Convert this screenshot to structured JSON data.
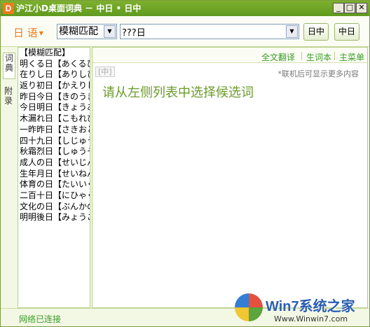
{
  "window": {
    "logo_letter": "D",
    "title": "沪江小D桌面词典 － 中日 • 日中",
    "min_symbol": "_",
    "max_symbol": "□",
    "close_symbol": "✕"
  },
  "toolbar": {
    "language": "日 语",
    "language_caret": "▼",
    "mode_value": "模糊匹配",
    "combo_arrow": "▼",
    "search_value": "???日",
    "btn_jc": "日中",
    "btn_rc": "中日"
  },
  "sidetabs": {
    "dict": "词典",
    "appendix": "附录"
  },
  "list": {
    "header": "【模糊匹配】",
    "items": [
      "明くる日【あくるひ】",
      "在りし日【ありしひ】",
      "返り初日【かえりしょにち】",
      "昨日今日【きのうきょう】",
      "今日明日【きょうあす】",
      "木漏れ日【こもれび】",
      "一昨昨日【さきおととい】",
      "四十九日【しじゅうくにち】",
      "秋霜烈日【しゅうそうれつじつ】",
      "成人の日【せいじんのひ】",
      "生年月日【せいねんがっぴ】",
      "体育の日【たいいくのひ】",
      "二百十日【にひゃくとおか】",
      "文化の日【ぶんかのひ】",
      "明明後日【みょうごにち】"
    ]
  },
  "main": {
    "link_full": "全文翻译",
    "link_vocab": "生词本",
    "link_menu": "主菜单",
    "tag": "[中]",
    "hint": "*联机后可显示更多内容",
    "prompt": "请从左侧列表中选择候选词"
  },
  "status": {
    "text": "网络已连接"
  },
  "watermark": {
    "text": "Win7系统之家",
    "url": "Www.Winwin7.com"
  }
}
